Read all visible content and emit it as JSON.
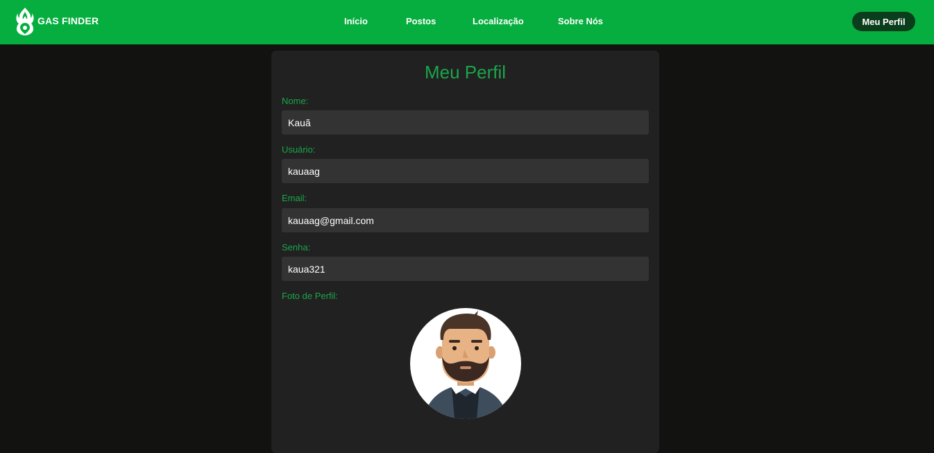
{
  "brand": {
    "name": "GAS FINDER"
  },
  "nav": {
    "inicio": "Início",
    "postos": "Postos",
    "localizacao": "Localização",
    "sobre": "Sobre Nós",
    "perfil": "Meu Perfil"
  },
  "profile": {
    "title": "Meu Perfil",
    "nome_label": "Nome:",
    "nome_value": "Kauã",
    "usuario_label": "Usuário:",
    "usuario_value": "kauaag",
    "email_label": "Email:",
    "email_value": "kauaag@gmail.com",
    "senha_label": "Senha:",
    "senha_value": "kaua321",
    "foto_label": "Foto de Perfil:"
  },
  "colors": {
    "accent": "#05ae3e",
    "label": "#1aa64a",
    "background": "#121311",
    "card": "#212121"
  }
}
